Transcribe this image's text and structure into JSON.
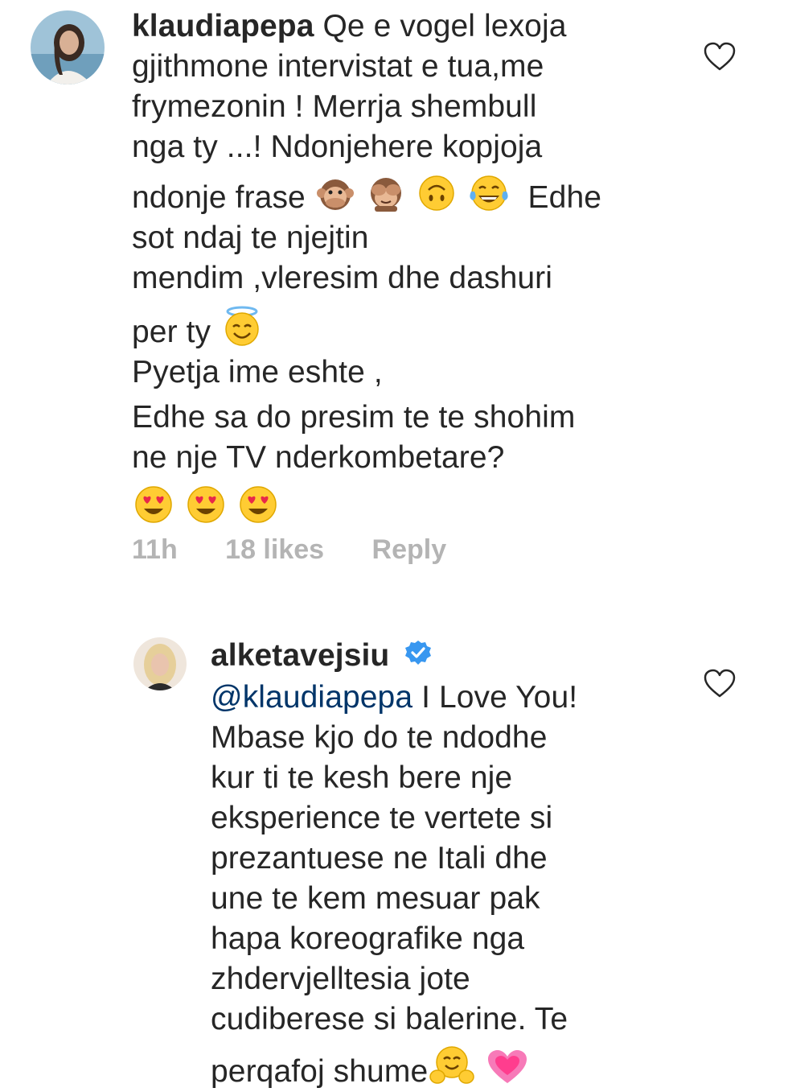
{
  "comments": [
    {
      "username": "klaudiapepa",
      "lines": [
        "Qe e vogel lexoja",
        "gjithmone intervistat e tua,me",
        "frymezonin ! Merrja shembull",
        "nga ty ...! Ndonjehere kopjoja",
        "ndonje frase",
        "Edhe",
        "sot ndaj te njejtin",
        "mendim ,vleresim dhe dashuri",
        "per ty",
        "Pyetja ime eshte ,",
        "Edhe sa do presim te te shohim",
        "ne nje TV nderkombetare?"
      ],
      "emojis_line5": [
        "speak-no-evil-monkey-icon",
        "see-no-evil-monkey-icon",
        "upside-down-face-icon",
        "tears-of-joy-icon"
      ],
      "emojis_line9": [
        "smiling-face-with-halo-icon"
      ],
      "emojis_line13": [
        "heart-eyes-icon",
        "heart-eyes-icon",
        "heart-eyes-icon"
      ],
      "time": "11h",
      "likes": "18 likes",
      "reply": "Reply"
    },
    {
      "username": "alketavejsiu",
      "verified": true,
      "mention": "@klaudiapepa",
      "lines": [
        "I Love You!",
        "Mbase kjo do te ndodhe",
        "kur ti te kesh bere nje",
        "eksperience te vertete si",
        "prezantuese ne Itali dhe",
        "une te kem mesuar pak",
        "hapa koreografike nga",
        "zhdervjelltesia jote",
        "cudiberese si balerine. Te",
        "perqafoj shume"
      ],
      "emojis_last": [
        "hugging-face-icon",
        "growing-heart-icon"
      ]
    }
  ],
  "colors": {
    "text": "#262626",
    "meta": "#b4b4b4",
    "mention": "#003569",
    "verified": "#3897f0"
  }
}
